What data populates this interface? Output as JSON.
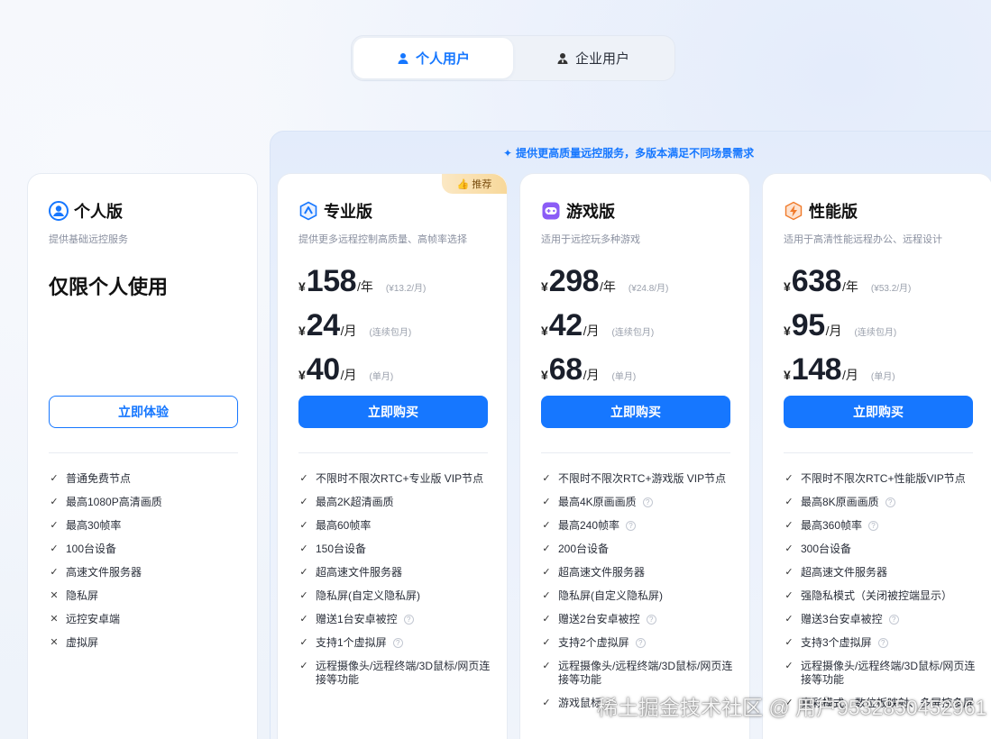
{
  "tabs": [
    {
      "label": "个人用户",
      "active": true,
      "icon": "user-icon"
    },
    {
      "label": "企业用户",
      "active": false,
      "icon": "business-user-icon"
    }
  ],
  "banner": "提供更高质量远控服务，多版本满足不同场景需求",
  "badge": "推荐",
  "plans": [
    {
      "name": "个人版",
      "desc": "提供基础远控服务",
      "personal_only": "仅限个人使用",
      "button": "立即体验",
      "icon": "person-circle-icon",
      "features": [
        {
          "text": "普通免费节点",
          "ok": true,
          "help": false
        },
        {
          "text": "最高1080P高清画质",
          "ok": true,
          "help": false
        },
        {
          "text": "最高30帧率",
          "ok": true,
          "help": false
        },
        {
          "text": "100台设备",
          "ok": true,
          "help": false
        },
        {
          "text": "高速文件服务器",
          "ok": true,
          "help": false
        },
        {
          "text": "隐私屏",
          "ok": false,
          "help": false
        },
        {
          "text": "远控安卓端",
          "ok": false,
          "help": false
        },
        {
          "text": "虚拟屏",
          "ok": false,
          "help": false
        }
      ]
    },
    {
      "name": "专业版",
      "desc": "提供更多远程控制高质量、高帧率选择",
      "button": "立即购买",
      "icon": "pro-shield-icon",
      "prices": [
        {
          "currency": "¥",
          "amount": "158",
          "unit": "/年",
          "note": "(¥13.2/月)"
        },
        {
          "currency": "¥",
          "amount": "24",
          "unit": "/月",
          "note": "(连续包月)"
        },
        {
          "currency": "¥",
          "amount": "40",
          "unit": "/月",
          "note": "(单月)"
        }
      ],
      "features": [
        {
          "text": "不限时不限次RTC+专业版 VIP节点",
          "ok": true,
          "help": false
        },
        {
          "text": "最高2K超清画质",
          "ok": true,
          "help": false
        },
        {
          "text": "最高60帧率",
          "ok": true,
          "help": false
        },
        {
          "text": "150台设备",
          "ok": true,
          "help": false
        },
        {
          "text": "超高速文件服务器",
          "ok": true,
          "help": false
        },
        {
          "text": "隐私屏(自定义隐私屏)",
          "ok": true,
          "help": false
        },
        {
          "text": "赠送1台安卓被控",
          "ok": true,
          "help": true
        },
        {
          "text": "支持1个虚拟屏",
          "ok": true,
          "help": true
        },
        {
          "text": "远程摄像头/远程终端/3D鼠标/网页连接等功能",
          "ok": true,
          "help": false
        }
      ]
    },
    {
      "name": "游戏版",
      "desc": "适用于远控玩多种游戏",
      "button": "立即购买",
      "icon": "gamepad-icon",
      "prices": [
        {
          "currency": "¥",
          "amount": "298",
          "unit": "/年",
          "note": "(¥24.8/月)"
        },
        {
          "currency": "¥",
          "amount": "42",
          "unit": "/月",
          "note": "(连续包月)"
        },
        {
          "currency": "¥",
          "amount": "68",
          "unit": "/月",
          "note": "(单月)"
        }
      ],
      "features": [
        {
          "text": "不限时不限次RTC+游戏版 VIP节点",
          "ok": true,
          "help": false
        },
        {
          "text": "最高4K原画画质",
          "ok": true,
          "help": true
        },
        {
          "text": "最高240帧率",
          "ok": true,
          "help": true
        },
        {
          "text": "200台设备",
          "ok": true,
          "help": false
        },
        {
          "text": "超高速文件服务器",
          "ok": true,
          "help": false
        },
        {
          "text": "隐私屏(自定义隐私屏)",
          "ok": true,
          "help": false
        },
        {
          "text": "赠送2台安卓被控",
          "ok": true,
          "help": true
        },
        {
          "text": "支持2个虚拟屏",
          "ok": true,
          "help": true
        },
        {
          "text": "远程摄像头/远程终端/3D鼠标/网页连接等功能",
          "ok": true,
          "help": false
        },
        {
          "text": "游戏鼠标",
          "ok": true,
          "help": false
        }
      ]
    },
    {
      "name": "性能版",
      "desc": "适用于高清性能远程办公、远程设计",
      "button": "立即购买",
      "icon": "lightning-icon",
      "prices": [
        {
          "currency": "¥",
          "amount": "638",
          "unit": "/年",
          "note": "(¥53.2/月)"
        },
        {
          "currency": "¥",
          "amount": "95",
          "unit": "/月",
          "note": "(连续包月)"
        },
        {
          "currency": "¥",
          "amount": "148",
          "unit": "/月",
          "note": "(单月)"
        }
      ],
      "features": [
        {
          "text": "不限时不限次RTC+性能版VIP节点",
          "ok": true,
          "help": false
        },
        {
          "text": "最高8K原画画质",
          "ok": true,
          "help": true
        },
        {
          "text": "最高360帧率",
          "ok": true,
          "help": true
        },
        {
          "text": "300台设备",
          "ok": true,
          "help": false
        },
        {
          "text": "超高速文件服务器",
          "ok": true,
          "help": false
        },
        {
          "text": "强隐私模式（关闭被控端显示）",
          "ok": true,
          "help": false
        },
        {
          "text": "赠送3台安卓被控",
          "ok": true,
          "help": true
        },
        {
          "text": "支持3个虚拟屏",
          "ok": true,
          "help": true
        },
        {
          "text": "远程摄像头/远程终端/3D鼠标/网页连接等功能",
          "ok": true,
          "help": false
        },
        {
          "text": "",
          "ok": true,
          "help": false
        },
        {
          "text": "真彩模式、数位板映射、多屏控多屏",
          "ok": true,
          "help": false
        }
      ]
    }
  ],
  "watermark": "稀土掘金技术社区 @ 用户9532850452961",
  "colors": {
    "accent": "#1677ff",
    "badge": "#f8d89a"
  }
}
